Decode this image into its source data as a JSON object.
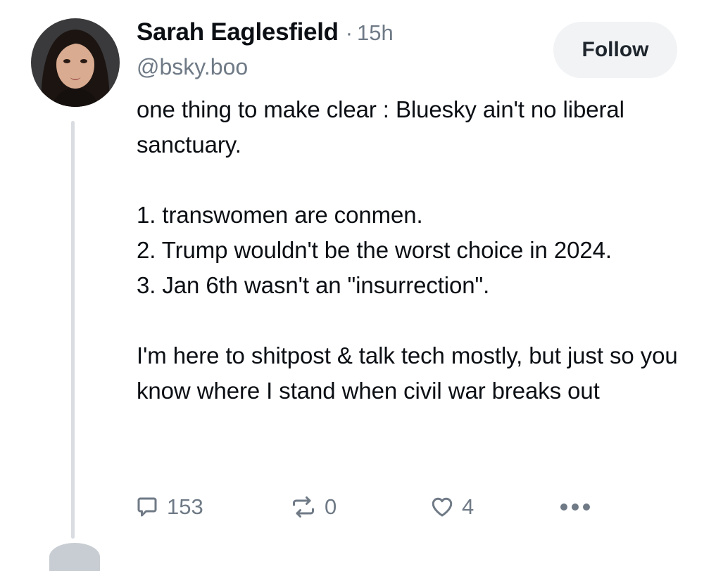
{
  "post": {
    "author": {
      "display_name": "Sarah Eaglesfield",
      "handle": "@bsky.boo"
    },
    "separator": "·",
    "timestamp": "15h",
    "follow_label": "Follow",
    "text": "one thing to make clear : Bluesky ain't no liberal sanctuary.\n\n1. transwomen are conmen.\n2. Trump wouldn't be the worst choice in 2024.\n3. Jan 6th wasn't an \"insurrection\".\n\nI'm here to shitpost & talk tech mostly, but just so you know where I stand when civil war breaks out",
    "actions": {
      "reply_count": "153",
      "repost_count": "0",
      "like_count": "4"
    }
  },
  "icons": {
    "reply": "speech-bubble-icon",
    "repost": "repost-arrows-icon",
    "like": "heart-outline-icon",
    "more": "ellipsis-icon"
  },
  "colors": {
    "muted_text": "#6f7a86",
    "follow_button_bg": "#f1f3f5",
    "thread_line": "#d9dde2"
  }
}
